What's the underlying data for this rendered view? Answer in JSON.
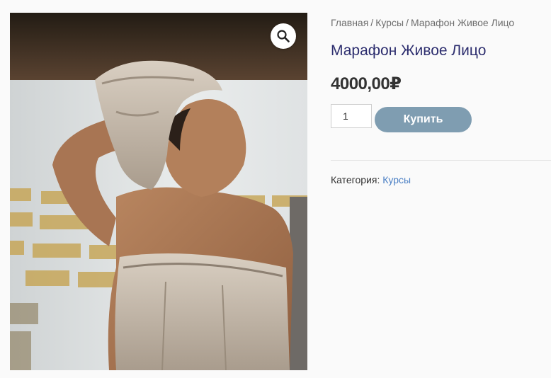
{
  "breadcrumb": {
    "items": [
      "Главная",
      "Курсы",
      "Марафон Живое Лицо"
    ],
    "separator": "/"
  },
  "product": {
    "title": "Марафон Живое Лицо",
    "price": "4000,00₽",
    "quantity": "1",
    "buy_label": "Купить",
    "category_label": "Категория:",
    "category_value": "Курсы"
  },
  "gallery": {
    "zoom_icon": "search-icon"
  },
  "colors": {
    "title": "#2c2d6e",
    "button": "#7f9db1",
    "link": "#4a7fc4"
  }
}
